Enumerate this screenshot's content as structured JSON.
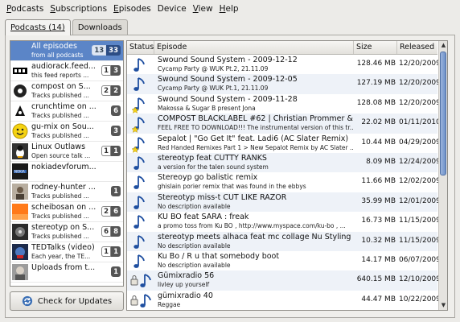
{
  "menu": [
    {
      "label": "Podcasts",
      "u": "P",
      "rest": "odcasts"
    },
    {
      "label": "Subscriptions",
      "u": "S",
      "rest": "ubscriptions"
    },
    {
      "label": "Episodes",
      "u": "E",
      "rest": "pisodes"
    },
    {
      "label": "Device",
      "u": "",
      "rest": "Device"
    },
    {
      "label": "View",
      "u": "V",
      "rest": "iew"
    },
    {
      "label": "Help",
      "u": "H",
      "rest": "elp"
    }
  ],
  "tabs": {
    "podcasts": "Podcasts (14)",
    "downloads": "Downloads"
  },
  "podcasts": [
    {
      "title": "All episodes",
      "sub": "from all podcasts",
      "new": "13",
      "dl": "33",
      "thumb": "none",
      "selected": true
    },
    {
      "title": "audiorack.feed...",
      "sub": "this feed reports ...",
      "new": "1",
      "dl": "3",
      "thumb": "audiorack"
    },
    {
      "title": "compost on S...",
      "sub": "Tracks published ...",
      "new": "2",
      "dl": "2",
      "thumb": "compost"
    },
    {
      "title": "crunchtime on ...",
      "sub": "Tracks published ...",
      "new": "",
      "dl": "6",
      "thumb": "crunchtime"
    },
    {
      "title": "gu-mix on Sou...",
      "sub": "Tracks published ...",
      "new": "",
      "dl": "3",
      "thumb": "smiley"
    },
    {
      "title": "Linux Outlaws",
      "sub": "Open source talk ...",
      "new": "1",
      "dl": "1",
      "thumb": "linux"
    },
    {
      "title": "nokiadevforum...",
      "sub": "",
      "new": "",
      "dl": "",
      "thumb": "nokia"
    },
    {
      "title": "rodney-hunter ...",
      "sub": "Tracks published ...",
      "new": "",
      "dl": "1",
      "thumb": "rodney"
    },
    {
      "title": "scheibosan on ...",
      "sub": "Tracks published ...",
      "new": "2",
      "dl": "6",
      "thumb": "orange"
    },
    {
      "title": "stereotyp on S...",
      "sub": "Tracks published ...",
      "new": "6",
      "dl": "8",
      "thumb": "stereotyp"
    },
    {
      "title": "TEDTalks (video)",
      "sub": "Each year, the TE...",
      "new": "1",
      "dl": "1",
      "thumb": "ted"
    },
    {
      "title": "Uploads from t...",
      "sub": "",
      "new": "",
      "dl": "1",
      "thumb": "face"
    }
  ],
  "check_updates": "Check for Updates",
  "columns": {
    "status": "Status",
    "episode": "Episode",
    "size": "Size",
    "released": "Released"
  },
  "episodes": [
    {
      "title": "Swound Sound System - 2009-12-12",
      "desc": "Cycamp Party @ WUK Pt.2, 21.11.09",
      "size": "128.46 MB",
      "released": "12/20/2009",
      "status": "downloaded"
    },
    {
      "title": "Swound Sound System - 2009-12-05",
      "desc": "Cycamp Party @ WUK Pt.1, 21.11.09",
      "size": "127.19 MB",
      "released": "12/20/2009",
      "status": "downloaded"
    },
    {
      "title": "Swound Sound System - 2009-11-28",
      "desc": "Makossa & Sugar B present Jona",
      "size": "128.08 MB",
      "released": "12/20/2009",
      "status": "downloaded-new"
    },
    {
      "title": "COMPOST BLACKLABEL #62 | Christian Prommer & T...",
      "desc": "FEEL FREE TO DOWNLOAD!!! The instrumental version of this tr...",
      "size": "22.02 MB",
      "released": "01/11/2010",
      "status": "downloaded-new"
    },
    {
      "title": "Sepalot | \"Go Get It\" feat. Ladi6 (AC Slater Remix)",
      "desc": "Red Handed Remixes Part 1 > New Sepalot Remix by AC Slater ...",
      "size": "10.44 MB",
      "released": "04/29/2009",
      "status": "downloaded-new"
    },
    {
      "title": "stereotyp feat CUTTY RANKS",
      "desc": "a version for the talen sound system",
      "size": "8.09 MB",
      "released": "12/24/2009",
      "status": "downloaded"
    },
    {
      "title": "Stereoyp go balistic remix",
      "desc": "ghislain porier remix that was found in the ebbys",
      "size": "11.66 MB",
      "released": "12/02/2009",
      "status": "downloaded"
    },
    {
      "title": "Stereotyp miss-t CUT LIKE RAZOR",
      "desc": "No description available",
      "size": "35.99 MB",
      "released": "12/01/2009",
      "status": "downloaded"
    },
    {
      "title": " KU BO feat SARA : freak",
      "desc": "a promo toss from Ku BO ,   http://www.myspace.com/ku-bo , ...",
      "size": "16.73 MB",
      "released": "11/15/2009",
      "status": "downloaded"
    },
    {
      "title": "stereotyp meets alhaca feat mc collage Nu Styling",
      "desc": "No description available",
      "size": "10.32 MB",
      "released": "11/15/2009",
      "status": "downloaded"
    },
    {
      "title": "Ku Bo  /  R u that somebody boot",
      "desc": "No description available",
      "size": "14.17 MB",
      "released": "06/07/2009",
      "status": "downloaded"
    },
    {
      "title": "Gümixradio 56",
      "desc": "livley up yourself",
      "size": "640.15 MB",
      "released": "12/10/2009",
      "status": "locked"
    },
    {
      "title": "gümixradio 40",
      "desc": "Reggae",
      "size": "44.47 MB",
      "released": "10/22/2009",
      "status": "locked"
    }
  ]
}
